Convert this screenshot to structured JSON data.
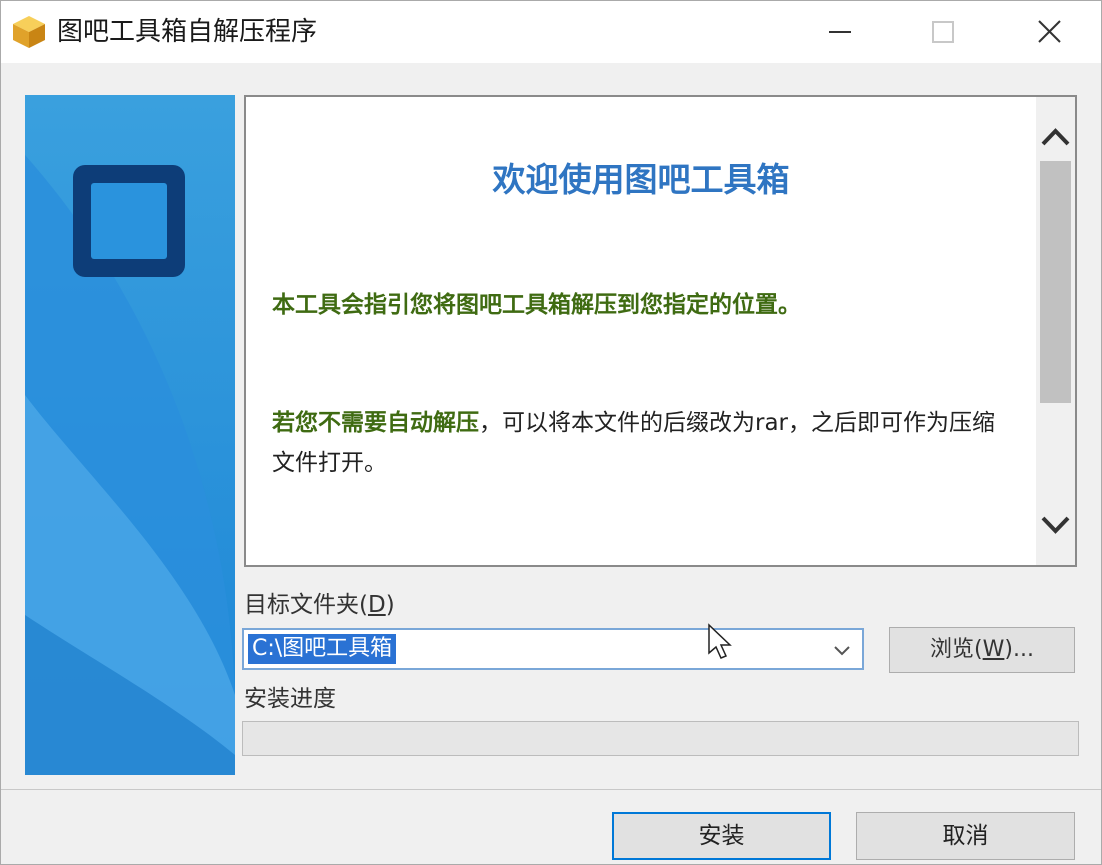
{
  "window": {
    "title": "图吧工具箱自解压程序",
    "minimize_icon": "minimize-icon",
    "maximize_icon": "maximize-icon",
    "close_icon": "close-icon"
  },
  "welcome": {
    "title": "欢迎使用图吧工具箱",
    "para1": "本工具会指引您将图吧工具箱解压到您指定的位置。",
    "para2_highlight": "若您不需要自动解压",
    "para2_rest": "，可以将本文件的后缀改为rar，之后即可作为压缩文件打开。"
  },
  "destination": {
    "label": "目标文件夹(",
    "label_key": "D",
    "label_end": ")",
    "value": "C:\\图吧工具箱",
    "browse_label": "浏览(",
    "browse_key": "W",
    "browse_end": ")..."
  },
  "progress": {
    "label": "安装进度",
    "value": 0
  },
  "buttons": {
    "install": "安装",
    "cancel": "取消"
  },
  "colors": {
    "accent": "#0078d7",
    "title_blue": "#2f75c2",
    "highlight_green": "#3f6b12",
    "selection": "#2a72d4"
  }
}
